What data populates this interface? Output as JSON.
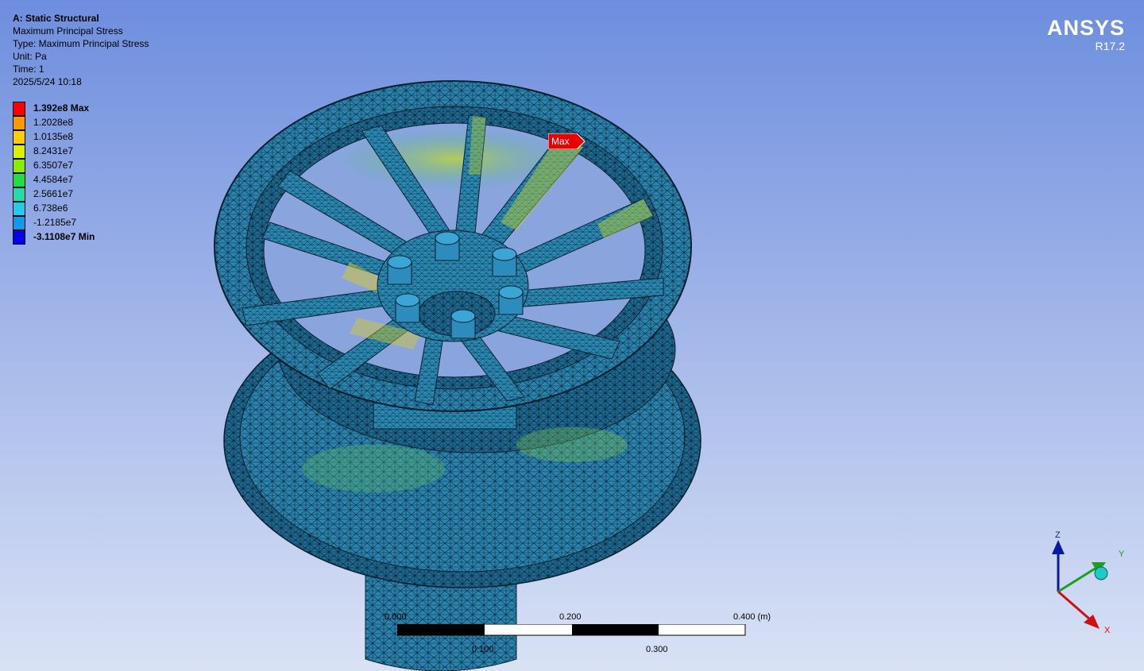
{
  "info": {
    "title": "A: Static Structural",
    "result": "Maximum Principal Stress",
    "type": "Type: Maximum Principal Stress",
    "unit": "Unit: Pa",
    "time": "Time: 1",
    "date": "2025/5/24 10:18"
  },
  "legend": [
    {
      "label": "1.392e8 Max",
      "color": "#ff0000",
      "bold": true
    },
    {
      "label": "1.2028e8",
      "color": "#ff9900",
      "bold": false
    },
    {
      "label": "1.0135e8",
      "color": "#ffcc00",
      "bold": false
    },
    {
      "label": "8.2431e7",
      "color": "#ddee00",
      "bold": false
    },
    {
      "label": "6.3507e7",
      "color": "#88ee00",
      "bold": false
    },
    {
      "label": "4.4584e7",
      "color": "#22dd44",
      "bold": false
    },
    {
      "label": "2.5661e7",
      "color": "#22ddaa",
      "bold": false
    },
    {
      "label": "6.738e6",
      "color": "#22ccee",
      "bold": false
    },
    {
      "label": "-1.2185e7",
      "color": "#1199ee",
      "bold": false
    },
    {
      "label": "-3.1108e7 Min",
      "color": "#0000ee",
      "bold": true
    }
  ],
  "brand": {
    "name": "ANSYS",
    "version": "R17.2"
  },
  "probe": {
    "max_label": "Max"
  },
  "scale_bar": {
    "labels_top": [
      "0.000",
      "0.200",
      "0.400 (m)"
    ],
    "labels_bottom": [
      "0.100",
      "0.300"
    ]
  },
  "triad": {
    "x": "X",
    "y": "Y",
    "z": "Z"
  },
  "colors": {
    "mesh_base": "#2a84b0",
    "mesh_lines": "#0d2a3a"
  }
}
